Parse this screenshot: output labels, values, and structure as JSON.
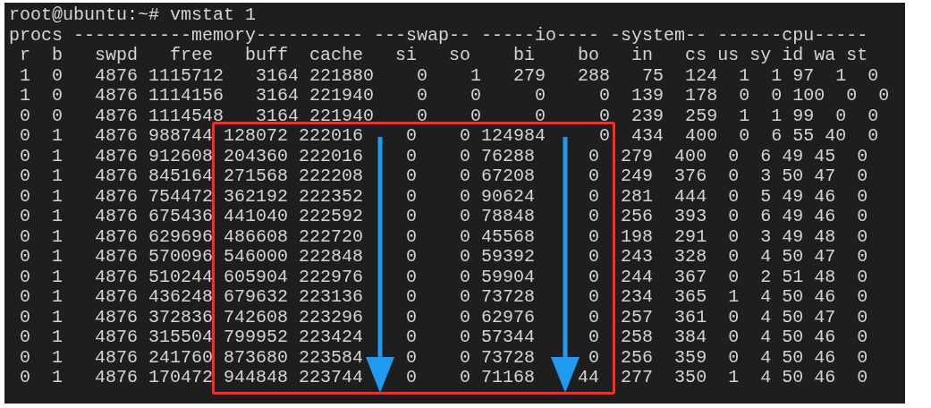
{
  "terminal": {
    "lines": [
      "root@ubuntu:~# vmstat 1",
      "procs -----------memory---------- ---swap-- -----io---- -system-- ------cpu-----",
      " r  b   swpd   free   buff  cache   si   so    bi    bo   in   cs us sy id wa st",
      " 1  0   4876 1115712   3164 221880    0    1   279   288   75  124  1  1 97  1  0",
      " 1  0   4876 1114156   3164 221940    0    0     0     0  139  178  0  0 100  0  0",
      " 0  0   4876 1114548   3164 221940    0    0     0     0  239  259  1  1 99  0  0",
      " 0  1   4876 988744 128072 222016    0    0 124984     0  434  400  0  6 55 40  0",
      " 0  1   4876 912608 204360 222016    0    0 76288     0  279  400  0  6 49 45  0",
      " 0  1   4876 845164 271568 222208    0    0 67208     0  249  376  0  3 50 47  0",
      " 0  1   4876 754472 362192 222352    0    0 90624     0  281  444  0  5 49 46  0",
      " 0  1   4876 675436 441040 222592    0    0 78848     0  256  393  0  6 49 46  0",
      " 0  1   4876 629696 486608 222720    0    0 45568     0  198  291  0  3 49 48  0",
      " 0  1   4876 570096 546000 222848    0    0 59392     0  243  328  0  4 50 47  0",
      " 0  1   4876 510244 605904 222976    0    0 59904     0  244  367  0  2 51 48  0",
      " 0  1   4876 436248 679632 223136    0    0 73728     0  234  365  1  4 50 46  0",
      " 0  1   4876 372836 742608 223296    0    0 62976     0  257  361  0  4 50 47  0",
      " 0  1   4876 315504 799952 223424    0    0 57344     0  258  384  0  4 50 46  0",
      " 0  1   4876 241760 873680 223584    0    0 73728     0  256  359  0  4 50 46  0",
      " 0  1   4876 170472 944848 223744    0    0 71168    44  277  350  1  4 50 46  0"
    ]
  }
}
